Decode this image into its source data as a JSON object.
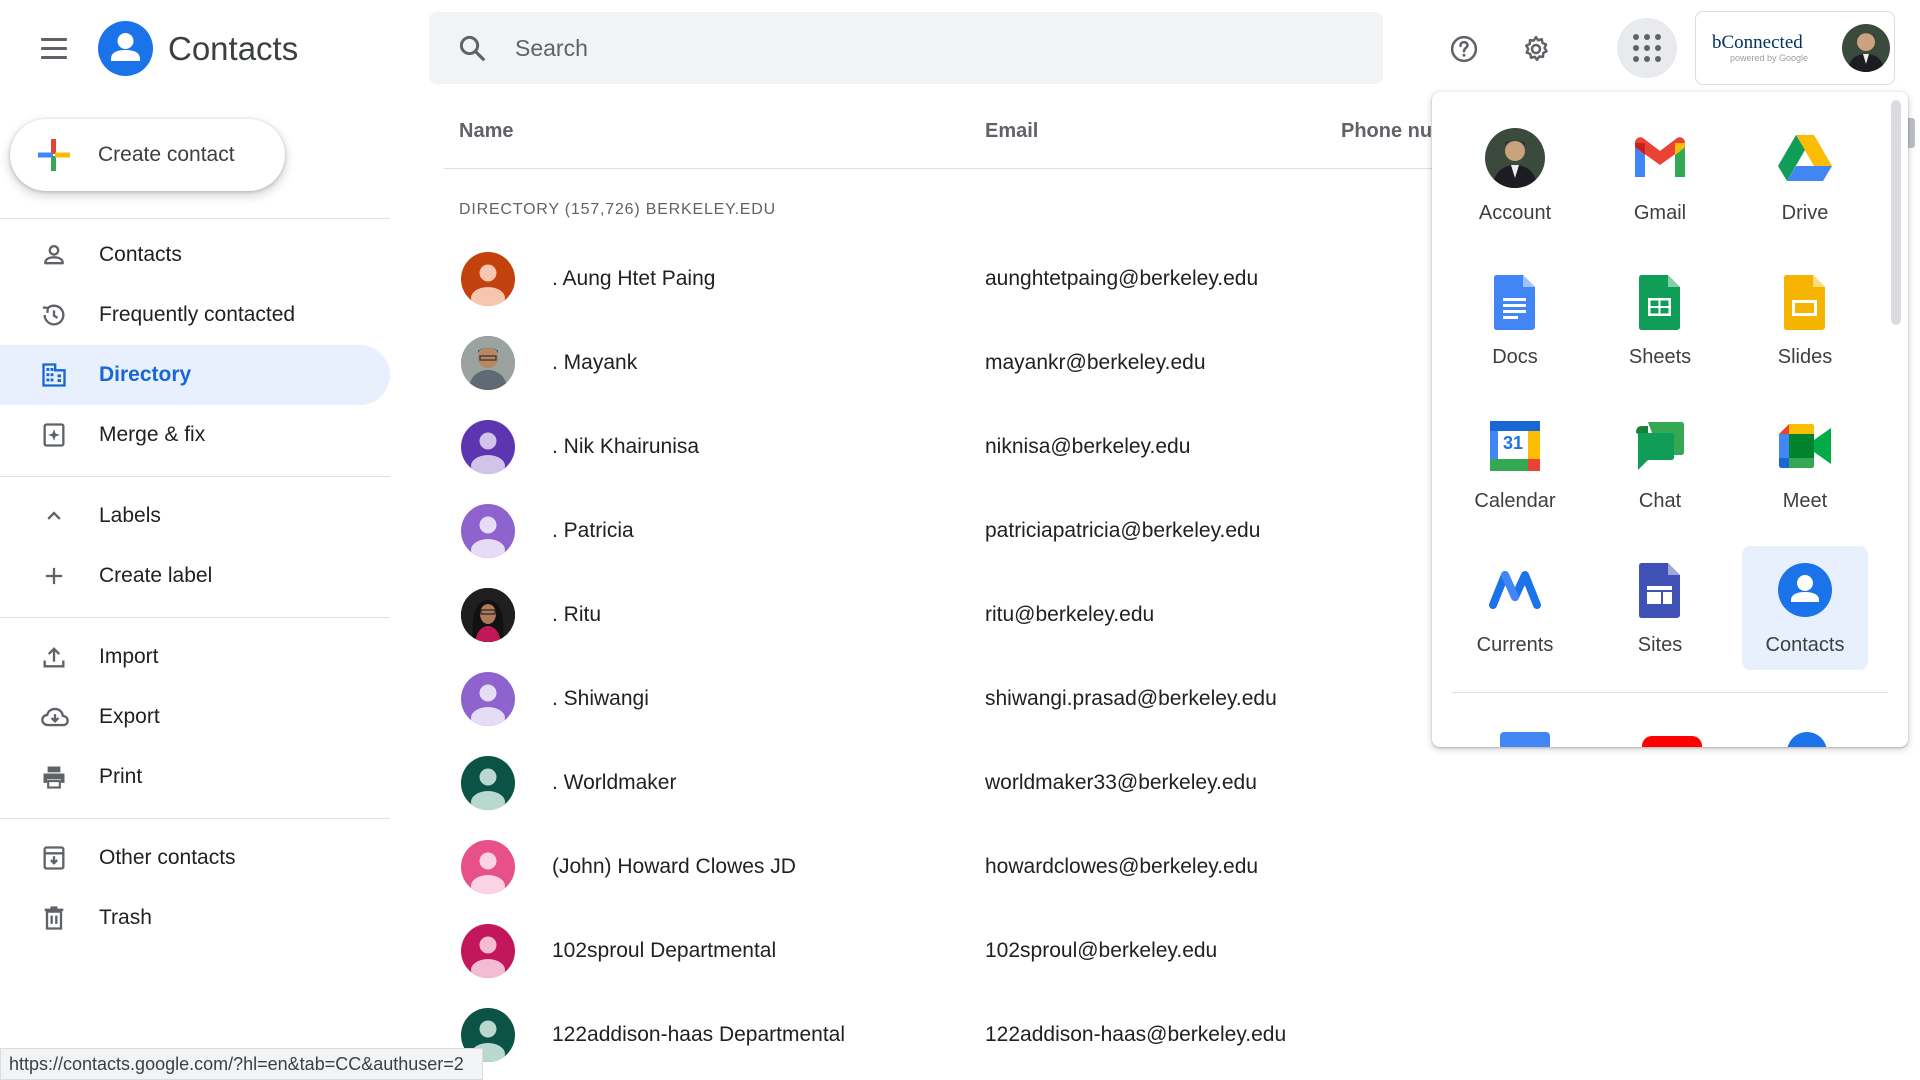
{
  "app": {
    "title": "Contacts"
  },
  "search": {
    "placeholder": "Search"
  },
  "account": {
    "brand_main": "bConnected",
    "brand_sub": "powered by Google"
  },
  "sidebar": {
    "create_label": "Create contact",
    "nav": [
      {
        "label": "Contacts",
        "icon": "person-icon"
      },
      {
        "label": "Frequently contacted",
        "icon": "history-icon"
      },
      {
        "label": "Directory",
        "icon": "building-icon",
        "active": true
      },
      {
        "label": "Merge & fix",
        "icon": "merge-icon"
      }
    ],
    "labels": [
      {
        "label": "Labels",
        "icon": "chevron-up-icon"
      },
      {
        "label": "Create label",
        "icon": "plus-icon"
      }
    ],
    "tools": [
      {
        "label": "Import",
        "icon": "upload-icon"
      },
      {
        "label": "Export",
        "icon": "cloud-download-icon"
      },
      {
        "label": "Print",
        "icon": "printer-icon"
      }
    ],
    "more": [
      {
        "label": "Other contacts",
        "icon": "archive-icon"
      },
      {
        "label": "Trash",
        "icon": "trash-icon"
      }
    ]
  },
  "list": {
    "columns": {
      "name": "Name",
      "email": "Email",
      "phone": "Phone nu"
    },
    "directory_label": "DIRECTORY (157,726) BERKELEY.EDU",
    "rows": [
      {
        "name": ". Aung Htet Paing",
        "email": "aunghtetpaing@berkeley.edu",
        "avatar_color": "#c2410c"
      },
      {
        "name": ". Mayank",
        "email": "mayankr@berkeley.edu",
        "avatar_color": "photo"
      },
      {
        "name": ". Nik Khairunisa",
        "email": "niknisa@berkeley.edu",
        "avatar_color": "#5e35b1"
      },
      {
        "name": ". Patricia",
        "email": "patriciapatricia@berkeley.edu",
        "avatar_color": "#8e63ce"
      },
      {
        "name": ". Ritu",
        "email": "ritu@berkeley.edu",
        "avatar_color": "photo"
      },
      {
        "name": ". Shiwangi",
        "email": "shiwangi.prasad@berkeley.edu",
        "avatar_color": "#8e63ce"
      },
      {
        "name": ". Worldmaker",
        "email": "worldmaker33@berkeley.edu",
        "avatar_color": "#0b5345"
      },
      {
        "name": "(John) Howard Clowes JD",
        "email": "howardclowes@berkeley.edu",
        "avatar_color": "#e8508a"
      },
      {
        "name": "102sproul Departmental",
        "email": "102sproul@berkeley.edu",
        "avatar_color": "#c2185b"
      },
      {
        "name": "122addison-haas Departmental",
        "email": "122addison-haas@berkeley.edu",
        "avatar_color": "#0b5345"
      }
    ]
  },
  "apps_panel": {
    "apps": [
      {
        "label": "Account",
        "icon": "account-avatar-icon"
      },
      {
        "label": "Gmail",
        "icon": "gmail-icon"
      },
      {
        "label": "Drive",
        "icon": "drive-icon"
      },
      {
        "label": "Docs",
        "icon": "docs-icon"
      },
      {
        "label": "Sheets",
        "icon": "sheets-icon"
      },
      {
        "label": "Slides",
        "icon": "slides-icon"
      },
      {
        "label": "Calendar",
        "icon": "calendar-icon",
        "calendar_day": "31"
      },
      {
        "label": "Chat",
        "icon": "chat-icon"
      },
      {
        "label": "Meet",
        "icon": "meet-icon"
      },
      {
        "label": "Currents",
        "icon": "currents-icon"
      },
      {
        "label": "Sites",
        "icon": "sites-icon"
      },
      {
        "label": "Contacts",
        "icon": "contacts-icon",
        "selected": true
      }
    ]
  },
  "status_bar": {
    "url": "https://contacts.google.com/?hl=en&tab=CC&authuser=2"
  }
}
